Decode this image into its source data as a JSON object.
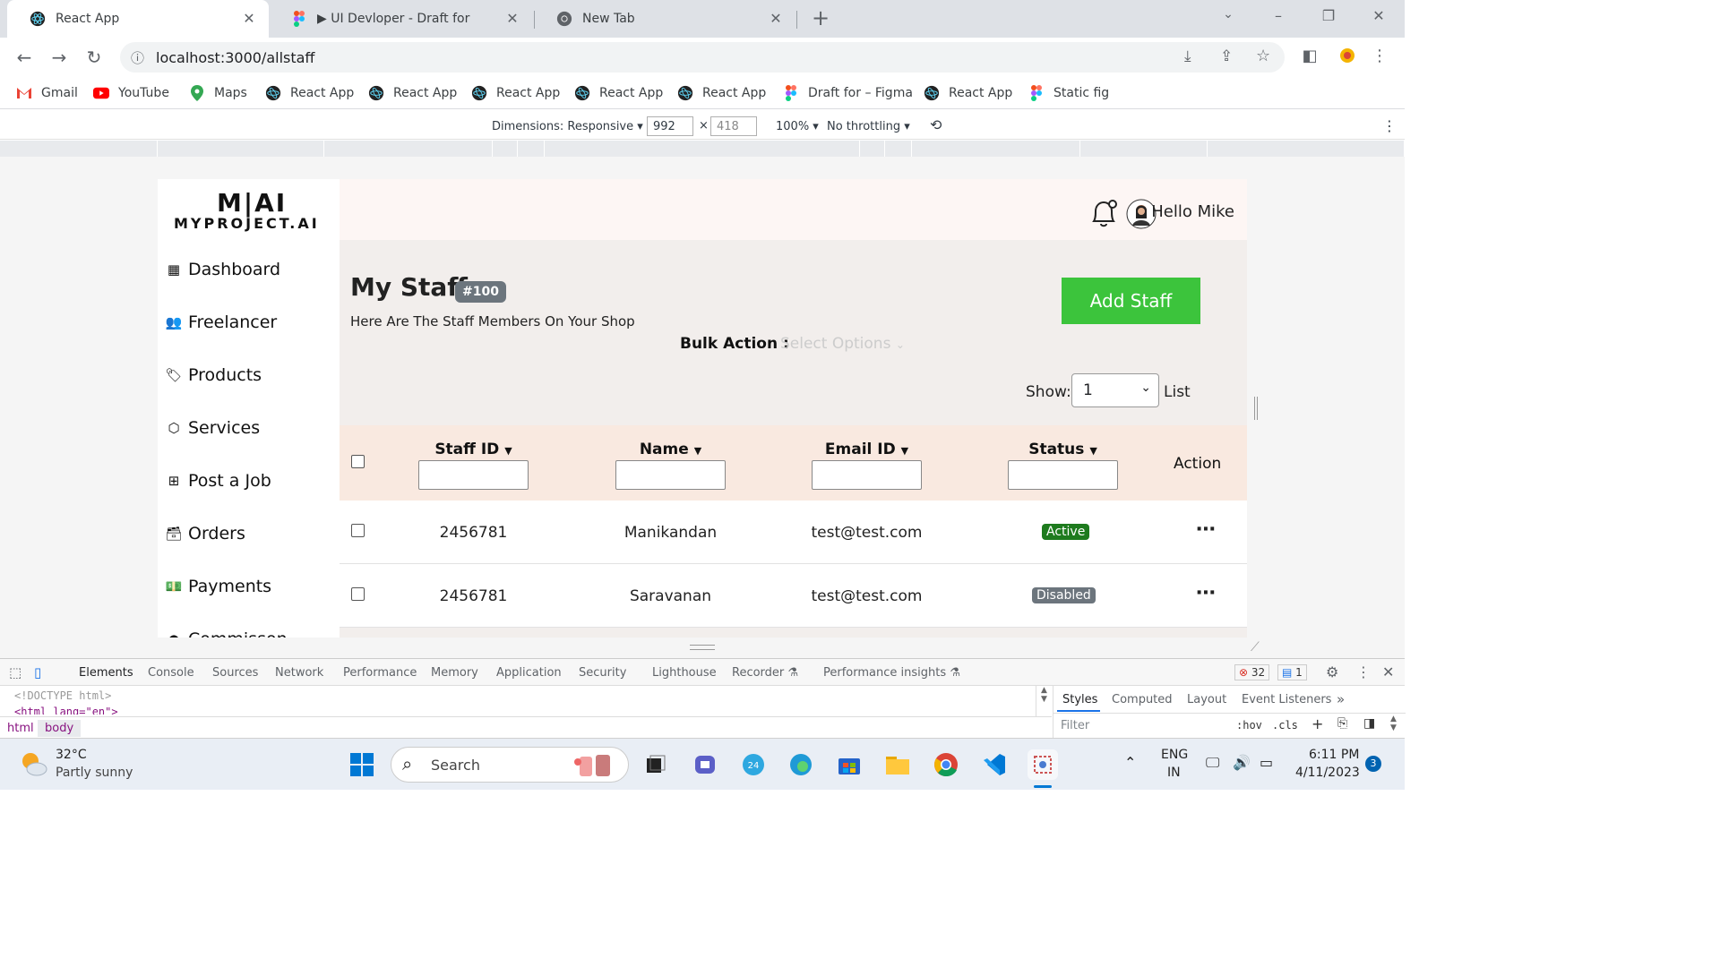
{
  "browser": {
    "tabs": [
      {
        "title": "React App"
      },
      {
        "title": "▶ UI Devloper - Draft for"
      },
      {
        "title": "New Tab"
      }
    ],
    "url": "localhost:3000/allstaff",
    "bookmarks": [
      "Gmail",
      "YouTube",
      "Maps",
      "React App",
      "React App",
      "React App",
      "React App",
      "React App",
      "Draft for – Figma",
      "React App",
      "Static fig"
    ]
  },
  "device_toolbar": {
    "dimensions_label": "Dimensions: Responsive",
    "width": "992",
    "height": "418",
    "zoom": "100%",
    "throttling": "No throttling"
  },
  "app": {
    "logo_top": "M|AI",
    "logo_bottom": "MYPROJECT.AI",
    "greeting": "Hello Mike",
    "nav": [
      "Dashboard",
      "Freelancer",
      "Products",
      "Services",
      "Post a Job",
      "Orders",
      "Payments",
      "Commisson"
    ],
    "page_title": "My Staff",
    "count_badge": "#100",
    "subtitle": "Here Are The Staff Members On Your Shop",
    "add_button": "Add Staff",
    "bulk_label": "Bulk Action :",
    "bulk_placeholder": "Select Options",
    "show_label": "Show:",
    "show_value": "1",
    "list_label": "List",
    "columns": [
      "Staff ID",
      "Name",
      "Email ID",
      "Status",
      "Action"
    ],
    "rows": [
      {
        "id": "2456781",
        "name": "Manikandan",
        "email": "test@test.com",
        "status": "Active"
      },
      {
        "id": "2456781",
        "name": "Saravanan",
        "email": "test@test.com",
        "status": "Disabled"
      }
    ],
    "colors": {
      "add_button": "#3cc43c",
      "active": "#1e7b1e",
      "disabled": "#6c757d",
      "table_header": "#f9e9e0"
    }
  },
  "devtools": {
    "tabs": [
      "Elements",
      "Console",
      "Sources",
      "Network",
      "Performance",
      "Memory",
      "Application",
      "Security",
      "Lighthouse",
      "Recorder",
      "Performance insights"
    ],
    "errors": "32",
    "messages": "1",
    "code_line1": "<!DOCTYPE html>",
    "code_line2": "<html lang=\"en\">",
    "crumbs": [
      "html",
      "body"
    ],
    "style_tabs": [
      "Styles",
      "Computed",
      "Layout",
      "Event Listeners"
    ],
    "filter_placeholder": "Filter",
    "hov": ":hov",
    "cls": ".cls"
  },
  "taskbar": {
    "temp": "32°C",
    "weather": "Partly sunny",
    "search": "Search",
    "lang1": "ENG",
    "lang2": "IN",
    "time": "6:11 PM",
    "date": "4/11/2023",
    "notif": "3"
  }
}
